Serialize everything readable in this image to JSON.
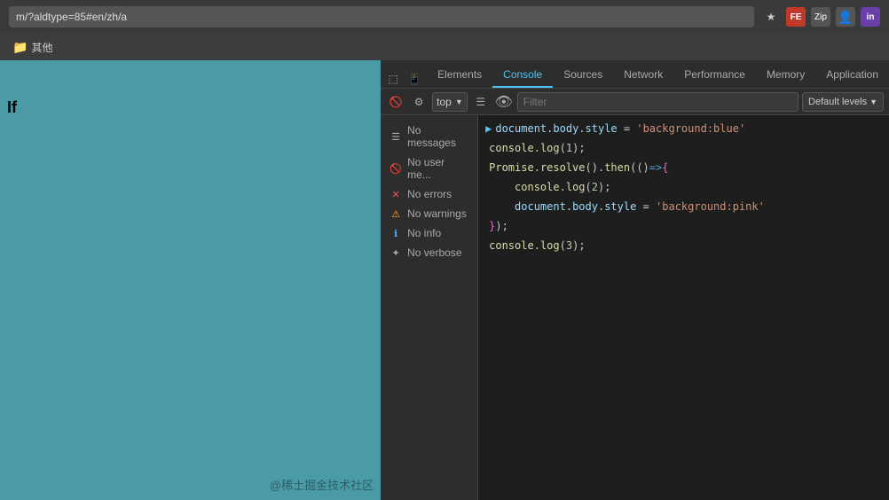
{
  "browser": {
    "url": "m/?aldtype=85#en/zh/a",
    "bookmark_label": "其他"
  },
  "devtools": {
    "tabs": [
      {
        "label": "Elements",
        "active": false
      },
      {
        "label": "Console",
        "active": true
      },
      {
        "label": "Sources",
        "active": false
      },
      {
        "label": "Network",
        "active": false
      },
      {
        "label": "Performance",
        "active": false
      },
      {
        "label": "Memory",
        "active": false
      },
      {
        "label": "Application",
        "active": false
      }
    ],
    "toolbar": {
      "top_selector": "top",
      "filter_placeholder": "Filter",
      "default_levels": "Default levels"
    },
    "sidebar": {
      "items": [
        {
          "label": "No messages",
          "icon": "messages"
        },
        {
          "label": "No user me...",
          "icon": "user"
        },
        {
          "label": "No errors",
          "icon": "error"
        },
        {
          "label": "No warnings",
          "icon": "warning"
        },
        {
          "label": "No info",
          "icon": "info"
        },
        {
          "label": "No verbose",
          "icon": "verbose"
        }
      ]
    },
    "console_code": [
      "document.body.style = 'background:blue'",
      "console.log(1);",
      "Promise.resolve().then(()=>{",
      "    console.log(2);",
      "    document.body.style = 'background:pink'",
      "});",
      "console.log(3);"
    ]
  },
  "page": {
    "text": "If",
    "watermark": "@稀土掘金技术社区"
  }
}
